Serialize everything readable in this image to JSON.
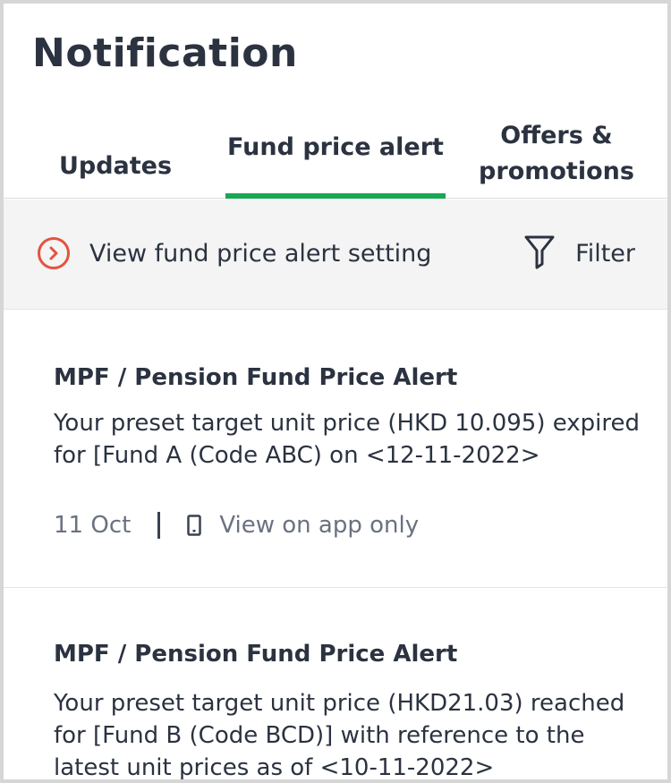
{
  "header": {
    "title": "Notification"
  },
  "tabs": [
    {
      "label": "Updates"
    },
    {
      "label": "Fund price alert"
    },
    {
      "label_line1": "Offers &",
      "label_line2": "promotions"
    }
  ],
  "toolbar": {
    "setting_link": "View fund price alert setting",
    "filter_label": "Filter"
  },
  "notifications": [
    {
      "title": "MPF / Pension Fund Price Alert",
      "body": "Your preset target unit price (HKD 10.095) expired for [Fund A (Code ABC) on <12-11-2022>",
      "date": "11 Oct",
      "channel": "View on app only"
    },
    {
      "title": "MPF / Pension Fund Price Alert",
      "body": "Your preset target unit price (HKD21.03) reached for [Fund B (Code BCD)] with reference to the latest unit prices as of <10-11-2022>"
    }
  ],
  "colors": {
    "accent": "#1aa655",
    "link_icon": "#e5523e",
    "text": "#2b3240"
  },
  "icons": [
    "chevron-right-circle-icon",
    "filter-icon",
    "phone-icon"
  ]
}
